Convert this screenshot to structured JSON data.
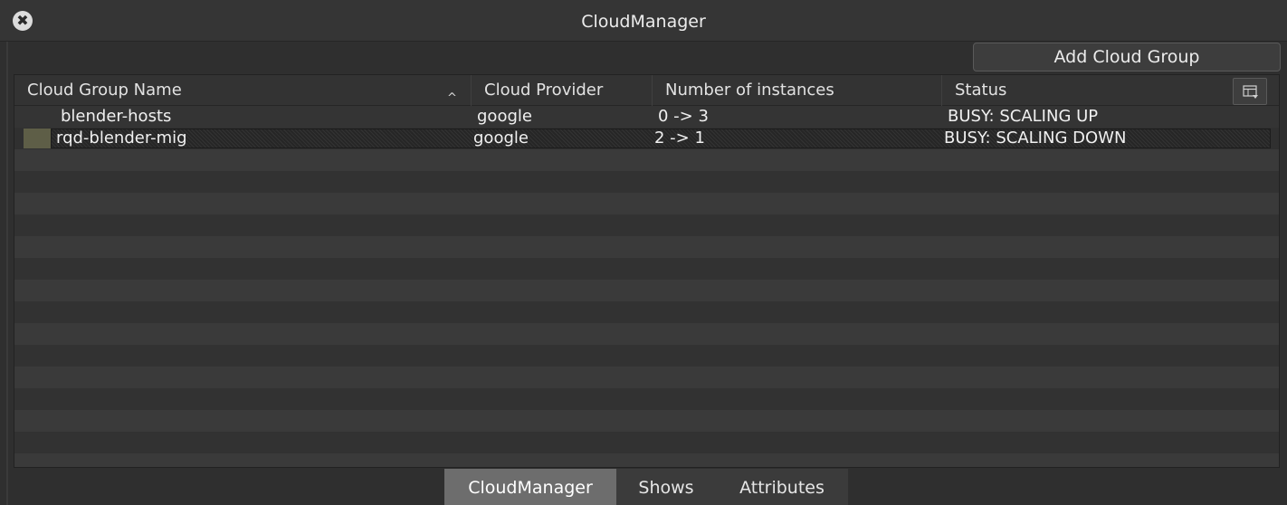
{
  "window": {
    "title": "CloudManager",
    "close_icon": "✖"
  },
  "toolbar": {
    "add_label": "Add Cloud Group"
  },
  "table": {
    "columns": [
      "Cloud Group Name",
      "Cloud Provider",
      "Number of instances",
      "Status"
    ],
    "sort_icon": "^",
    "rows": [
      {
        "name": "blender-hosts",
        "provider": "google",
        "instances": "0 -> 3",
        "status": "BUSY: SCALING UP"
      },
      {
        "name": "rqd-blender-mig",
        "provider": "google",
        "instances": "2 -> 1",
        "status": "BUSY: SCALING DOWN"
      }
    ]
  },
  "tabs": [
    {
      "label": "CloudManager",
      "active": true
    },
    {
      "label": "Shows",
      "active": false
    },
    {
      "label": "Attributes",
      "active": false
    }
  ],
  "colors": {
    "background": "#2f2f2f",
    "selected_marker": "#5e5e47",
    "active_tab": "#6d6d6d"
  }
}
